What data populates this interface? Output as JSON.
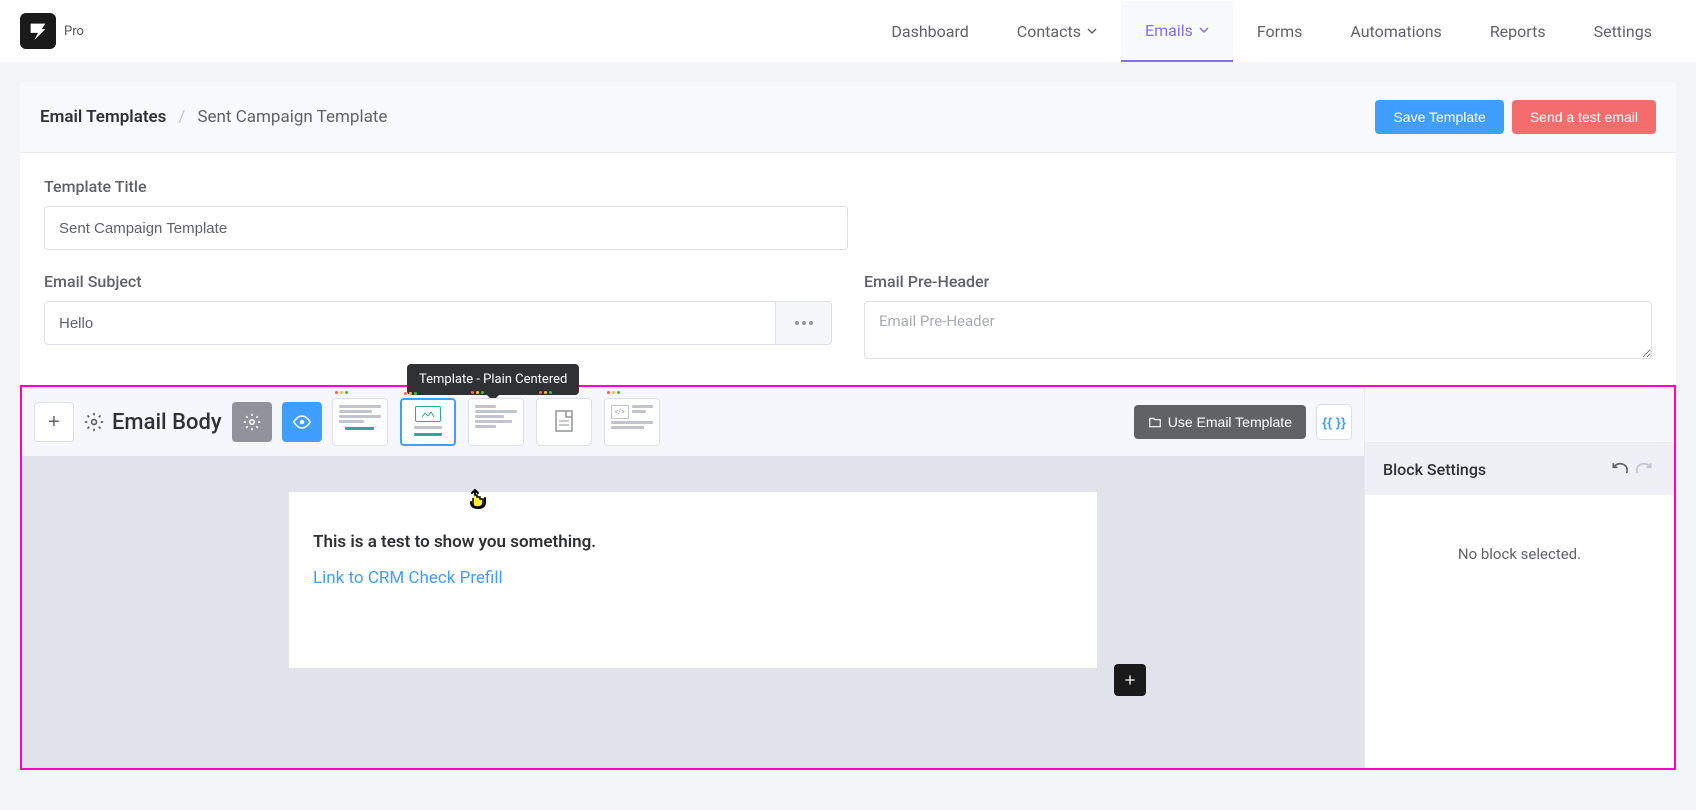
{
  "brand": {
    "pro_label": "Pro"
  },
  "nav": {
    "items": [
      {
        "label": "Dashboard"
      },
      {
        "label": "Contacts",
        "dropdown": true
      },
      {
        "label": "Emails",
        "dropdown": true,
        "active": true
      },
      {
        "label": "Forms"
      },
      {
        "label": "Automations"
      },
      {
        "label": "Reports"
      },
      {
        "label": "Settings"
      }
    ]
  },
  "breadcrumb": {
    "root": "Email Templates",
    "current": "Sent Campaign Template"
  },
  "header_buttons": {
    "save": "Save Template",
    "test": "Send a test email"
  },
  "form": {
    "title_label": "Template Title",
    "title_value": "Sent Campaign Template",
    "subject_label": "Email Subject",
    "subject_value": "Hello",
    "preheader_label": "Email Pre-Header",
    "preheader_placeholder": "Email Pre-Header"
  },
  "editor": {
    "body_title": "Email Body",
    "tooltip": "Template - Plain Centered",
    "use_template": "Use Email Template",
    "shortcode": "{{ }}",
    "content_text": "This is a test to show you something.",
    "content_link": "Link to CRM Check Prefill"
  },
  "sidebar": {
    "settings_title": "Block Settings",
    "no_block": "No block selected."
  }
}
